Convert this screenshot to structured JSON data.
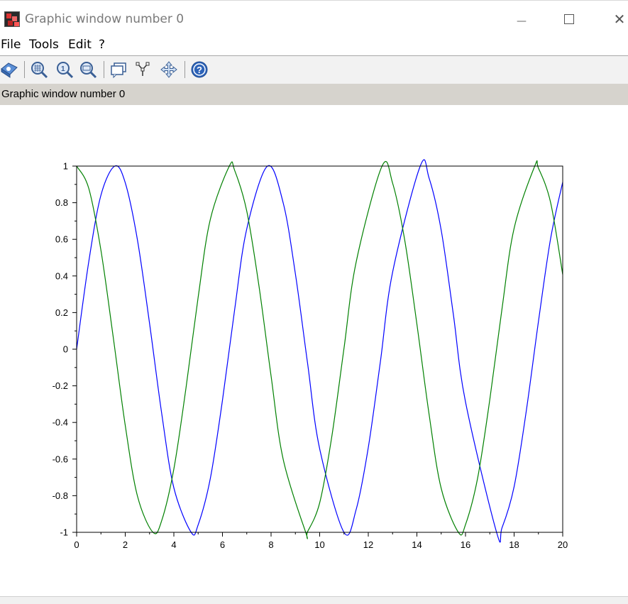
{
  "window": {
    "title": "Graphic window number 0",
    "controls": {
      "minimize": "—",
      "close": "✕"
    }
  },
  "menu": [
    {
      "label": "File"
    },
    {
      "label": "Tools"
    },
    {
      "label": "Edit"
    },
    {
      "label": "?"
    }
  ],
  "toolbar": [
    {
      "icon": "rotate-3d-icon"
    },
    {
      "icon": "zoom-region-icon"
    },
    {
      "icon": "zoom-reset-icon"
    },
    {
      "icon": "zoom-out-icon"
    },
    {
      "icon": "datatip-icon"
    },
    {
      "icon": "datatip-edit-icon"
    },
    {
      "icon": "pan-icon"
    },
    {
      "icon": "help-icon"
    }
  ],
  "infobar": {
    "text": "Graphic window number 0"
  },
  "chart_data": {
    "type": "line",
    "title": "",
    "xlabel": "",
    "ylabel": "",
    "xlim": [
      0,
      20
    ],
    "ylim": [
      -1,
      1
    ],
    "x_ticks": [
      "0",
      "2",
      "4",
      "6",
      "8",
      "10",
      "12",
      "14",
      "16",
      "18",
      "20"
    ],
    "y_ticks": [
      "-1",
      "-0.8",
      "-0.6",
      "-0.4",
      "-0.2",
      "0",
      "0.2",
      "0.4",
      "0.6",
      "0.8",
      "1"
    ],
    "grid": false,
    "series": [
      {
        "color": "#0000ff",
        "x": [
          0,
          0.5,
          1,
          1.5708,
          2,
          2.5,
          3,
          3.5,
          4,
          4.7124,
          5,
          5.5,
          6,
          6.5,
          7,
          7.854,
          8.5,
          9,
          9.5,
          10,
          11.0,
          11.5,
          12,
          12.5,
          13,
          14.1372,
          14.5,
          15,
          15.5,
          16,
          17.2788,
          17.5,
          18,
          18.5,
          19,
          19.5,
          20
        ],
        "values": [
          0.0,
          0.479,
          0.841,
          1.0,
          0.909,
          0.598,
          0.141,
          -0.351,
          -0.757,
          -1.0,
          -0.959,
          -0.706,
          -0.279,
          0.215,
          0.657,
          1.0,
          0.798,
          0.412,
          -0.075,
          -0.544,
          -1.0,
          -0.876,
          -0.537,
          -0.066,
          0.42,
          1.0,
          0.935,
          0.65,
          0.19,
          -0.288,
          -1.0,
          -0.976,
          -0.751,
          -0.338,
          0.15,
          0.603,
          0.913
        ]
      },
      {
        "color": "#008000",
        "x": [
          0,
          0.5,
          1,
          1.5,
          2,
          2.5,
          3.1416,
          3.5,
          4,
          4.5,
          5,
          5.5,
          6.2832,
          6.5,
          7,
          7.5,
          8,
          8.5,
          9.4248,
          9.5,
          10,
          10.5,
          11,
          11.5,
          12.5664,
          13,
          13.5,
          14,
          14.5,
          15,
          15.708,
          16,
          16.5,
          17,
          17.5,
          18,
          18.8496,
          19,
          19.5,
          20
        ],
        "values": [
          1.0,
          0.878,
          0.54,
          0.071,
          -0.416,
          -0.801,
          -1.0,
          -0.936,
          -0.654,
          -0.211,
          0.284,
          0.709,
          1.0,
          0.977,
          0.754,
          0.347,
          -0.146,
          -0.602,
          -1.0,
          -0.997,
          -0.839,
          -0.476,
          0.004,
          0.475,
          1.0,
          0.907,
          0.595,
          0.137,
          -0.354,
          -0.76,
          -1.0,
          -0.958,
          -0.703,
          -0.275,
          0.219,
          0.66,
          1.0,
          0.989,
          0.802,
          0.408
        ]
      }
    ]
  }
}
